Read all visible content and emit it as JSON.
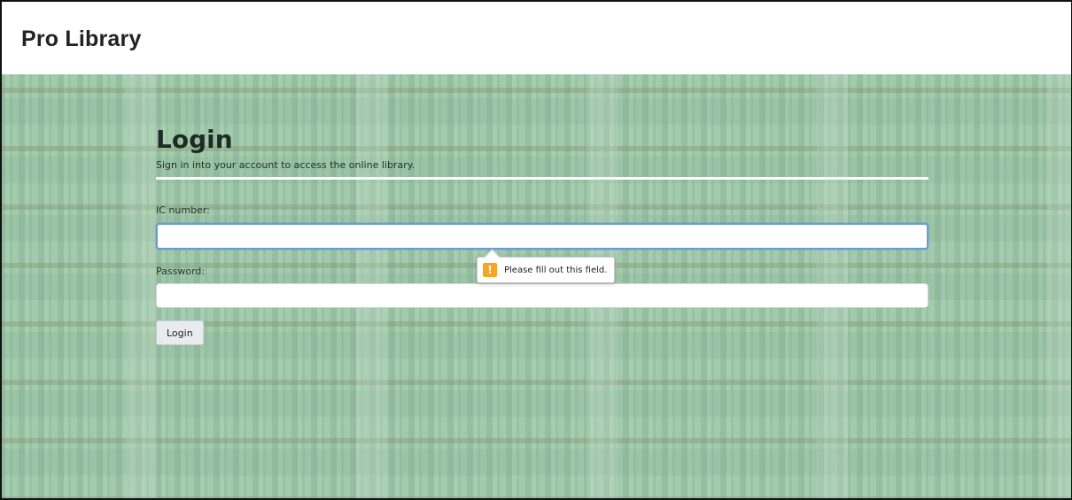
{
  "navbar": {
    "brand": "Pro Library"
  },
  "login": {
    "title": "Login",
    "subtitle": "Sign in into your account to access the online library.",
    "ic_label": "IC number:",
    "ic_value": "",
    "password_label": "Password:",
    "password_value": "",
    "button_label": "Login"
  },
  "validation": {
    "message": "Please fill out this field.",
    "icon": "warning-icon",
    "icon_glyph": "!",
    "icon_color": "#f5a623"
  },
  "colors": {
    "hero_tint": "#a9cdb2",
    "focus_border": "#6c9bd2"
  }
}
